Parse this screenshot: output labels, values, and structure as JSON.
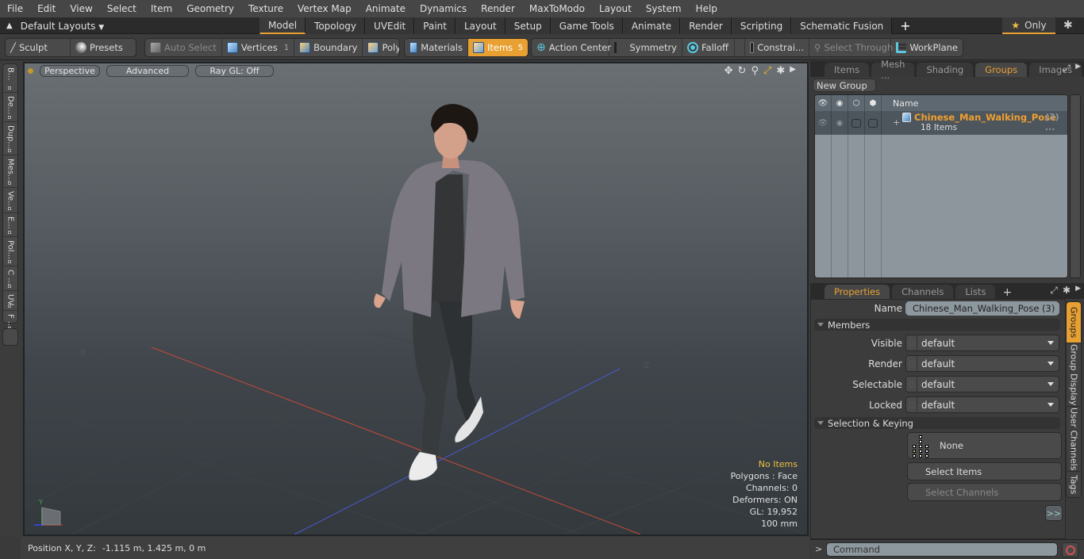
{
  "menu": [
    "File",
    "Edit",
    "View",
    "Select",
    "Item",
    "Geometry",
    "Texture",
    "Vertex Map",
    "Animate",
    "Dynamics",
    "Render",
    "MaxToModo",
    "Layout",
    "System",
    "Help"
  ],
  "layout_bar": {
    "layout_selector": "Default Layouts",
    "tabs": [
      "Model",
      "Topology",
      "UVEdit",
      "Paint",
      "Layout",
      "Setup",
      "Game Tools",
      "Animate",
      "Render",
      "Scripting",
      "Schematic Fusion"
    ],
    "active_tab": "Model",
    "only_label": "Only"
  },
  "toolbar": {
    "sculpt": "Sculpt",
    "presets": "Presets",
    "auto_select": "Auto Select",
    "vertices": "Vertices",
    "vertices_count": "1",
    "boundary": "Boundary",
    "polygons": "Polygons",
    "materials": "Materials",
    "items": "Items",
    "items_count": "5",
    "action_center": "Action Center",
    "symmetry": "Symmetry",
    "falloff": "Falloff",
    "constraints": "Constrai...",
    "select_through": "Select Through",
    "workplane": "WorkPlane"
  },
  "left_tabs": [
    "B...",
    "De...",
    "Dup...",
    "Mes...",
    "Ve...",
    "E...",
    "Pol...",
    "C ...",
    "UV",
    "F ..."
  ],
  "viewport": {
    "view_mode": "Perspective",
    "shading": "Advanced",
    "raygl": "Ray GL: Off",
    "axis_labels": {
      "neg_x": "-X",
      "neg_z": "-Z"
    },
    "stats": [
      "No Items",
      "Polygons : Face",
      "Channels: 0",
      "Deformers: ON",
      "GL: 19,952",
      "100 mm"
    ]
  },
  "status_bar": {
    "label": "Position X, Y, Z:",
    "value": "-1.115 m, 1.425 m, 0 m"
  },
  "top_panel": {
    "tabs": [
      "Items",
      "Mesh ...",
      "Shading",
      "Groups",
      "Images"
    ],
    "active_tab": "Groups",
    "new_group": "New Group",
    "columns": {
      "name": "Name"
    },
    "groups": [
      {
        "name": "Chinese_Man_Walking_Pose",
        "suffix": "(3) ...",
        "count": "18 Items"
      }
    ]
  },
  "properties_panel": {
    "tabs": [
      "Properties",
      "Channels",
      "Lists"
    ],
    "active_tab": "Properties",
    "name_label": "Name",
    "name_value": "Chinese_Man_Walking_Pose (3)",
    "members_section": "Members",
    "fields": [
      {
        "label": "Visible",
        "value": "default"
      },
      {
        "label": "Render",
        "value": "default"
      },
      {
        "label": "Selectable",
        "value": "default"
      },
      {
        "label": "Locked",
        "value": "default"
      }
    ],
    "selection_section": "Selection & Keying",
    "none_button": "None",
    "select_items": "Select Items",
    "select_channels": "Select Channels",
    "more": ">>",
    "side_tabs": [
      "Groups",
      "Group Display",
      "User Channels",
      "Tags"
    ],
    "active_side_tab": "Groups"
  },
  "command": {
    "prompt": ">",
    "placeholder": "Command"
  },
  "colors": {
    "accent": "#e8a033",
    "highlight_text": "#f0c040",
    "x_axis": "#c84a3a",
    "z_axis": "#4a5ad0"
  }
}
